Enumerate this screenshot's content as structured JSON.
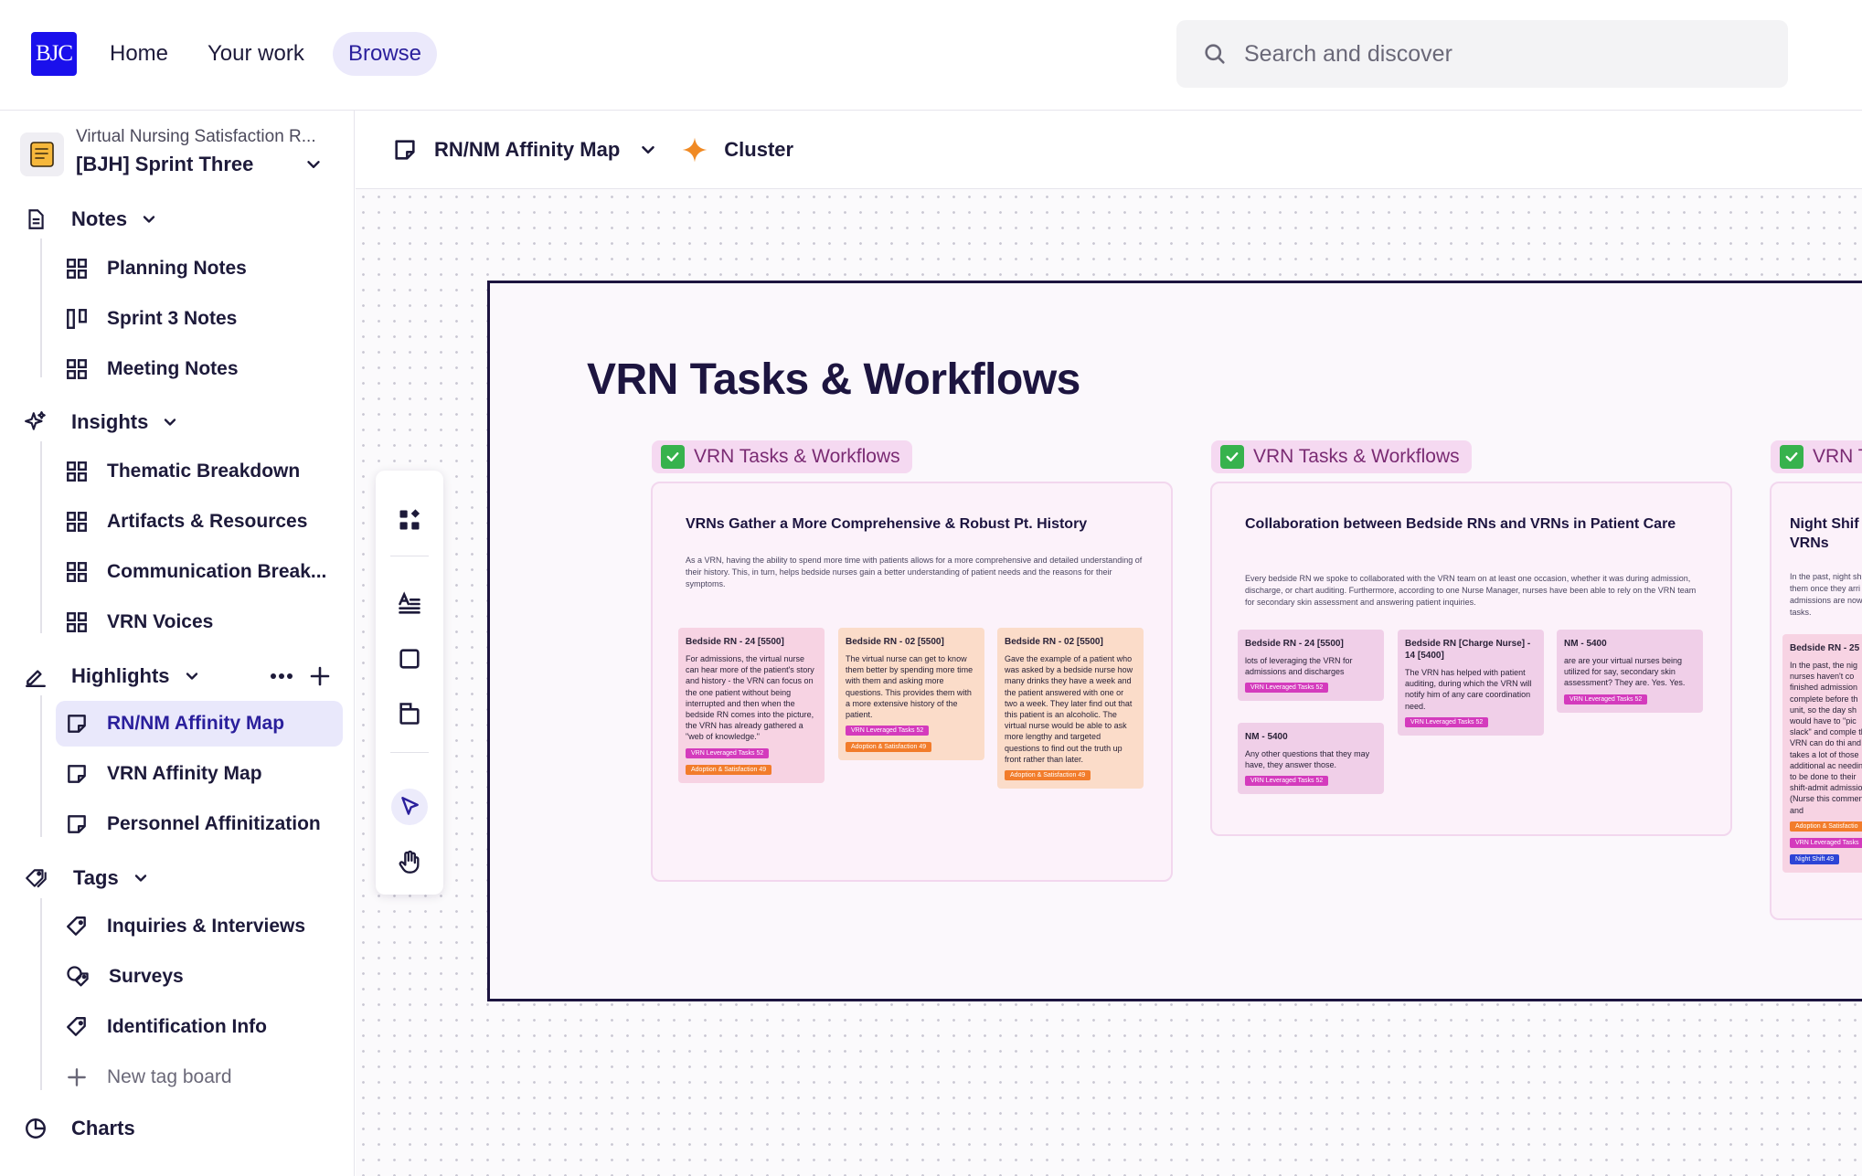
{
  "header": {
    "logo_text": "BJC",
    "nav": [
      "Home",
      "Your work",
      "Browse"
    ],
    "search_placeholder": "Search and discover"
  },
  "sidebar": {
    "project_subtitle": "Virtual Nursing Satisfaction R...",
    "project_name": "[BJH] Sprint Three",
    "notes": {
      "label": "Notes",
      "items": [
        "Planning Notes",
        "Sprint 3 Notes",
        "Meeting Notes"
      ]
    },
    "insights": {
      "label": "Insights",
      "items": [
        "Thematic Breakdown",
        "Artifacts & Resources",
        "Communication Break...",
        "VRN Voices"
      ]
    },
    "highlights": {
      "label": "Highlights",
      "items": [
        "RN/NM Affinity Map",
        "VRN Affinity Map",
        "Personnel Affinitization"
      ]
    },
    "tags": {
      "label": "Tags",
      "items": [
        "Inquiries & Interviews",
        "Surveys",
        "Identification Info"
      ],
      "new_label": "New tag board"
    },
    "charts": {
      "label": "Charts"
    }
  },
  "toolbar": {
    "board_name": "RN/NM Affinity Map",
    "cluster_label": "Cluster"
  },
  "board": {
    "title": "VRN Tasks & Workflows",
    "groups": [
      {
        "label": "VRN Tasks & Workflows",
        "title": "VRNs Gather a More Comprehensive & Robust Pt. History",
        "description": "As a VRN, having the ability to spend more time with patients allows for a more comprehensive and detailed understanding of their history. This, in turn, helps bedside nurses gain a better understanding of patient needs and the reasons for their symptoms.",
        "notes": [
          {
            "header": "Bedside RN - 24 [5500]",
            "body": "For admissions, the virtual nurse can hear more of the patient's story and history - the VRN can focus on the one patient without being interrupted and then when the bedside RN comes into the picture, the VRN has already gathered a \"web of knowledge.\"",
            "tags": [
              "VRN Leveraged Tasks 52",
              "Adoption & Satisfaction 49"
            ]
          },
          {
            "header": "Bedside RN - 02 [5500]",
            "body": "The virtual nurse can get to know them better by spending more time with them and asking more questions. This provides them with a more extensive history of the patient.",
            "tags": [
              "VRN Leveraged Tasks 52",
              "Adoption & Satisfaction 49"
            ]
          },
          {
            "header": "Bedside RN - 02 [5500]",
            "body": "Gave the example of a patient who was asked by a bedside nurse how many drinks they have a week and the patient answered with one or two a week. They later find out that this patient is an alcoholic. The virtual nurse would be able to ask more lengthy and targeted questions to find out the truth up front rather than later.",
            "tags": [
              "Adoption & Satisfaction 49"
            ]
          }
        ]
      },
      {
        "label": "VRN Tasks & Workflows",
        "title": "Collaboration between Bedside RNs and VRNs in Patient Care",
        "description": "Every bedside RN we spoke to collaborated with the VRN team on at least one occasion, whether it was during admission, discharge, or chart auditing. Furthermore, according to one Nurse Manager, nurses have been able to rely on the VRN team for secondary skin assessment and answering patient inquiries.",
        "notes": [
          {
            "header": "Bedside RN - 24 [5500]",
            "body": "lots of leveraging the VRN for admissions and discharges",
            "tags": [
              "VRN Leveraged Tasks 52"
            ]
          },
          {
            "header": "Bedside RN [Charge Nurse] - 14 [5400]",
            "body": "The VRN has helped with patient auditing, during which the VRN will notify him of any care coordination need.",
            "tags": [
              "VRN Leveraged Tasks 52"
            ]
          },
          {
            "header": "NM - 5400",
            "body": "are are your virtual nurses being utilized for say, secondary skin assessment? They are. Yes. Yes.",
            "tags": [
              "VRN Leveraged Tasks 52"
            ]
          },
          {
            "header": "NM - 5400",
            "body": "Any other questions that they may have, they answer those.",
            "tags": [
              "VRN Leveraged Tasks 52"
            ]
          }
        ]
      },
      {
        "label": "VRN T",
        "title": "Night Shif VRNs",
        "description": "In the past, night sh them once they arri admissions are now tasks.",
        "notes": [
          {
            "header": "Bedside RN - 25",
            "body": "In the past, the nig nurses haven't co finished admission complete before th unit, so the day sh would have to \"pic slack\" and comple the VRN can do thi and it takes a lot of those additional ac needing to be done to their shift-admit admissions (Nurse this comment and",
            "tags": [
              "Adoption & Satisfactio",
              "VRN Leveraged Tasks",
              "Night Shift 49"
            ]
          }
        ]
      }
    ]
  },
  "colors": {
    "accent": "#2a1f9c",
    "logo": "#1a10ec",
    "board_border": "#1d1540",
    "group_label_bg": "#f5d9f1"
  }
}
